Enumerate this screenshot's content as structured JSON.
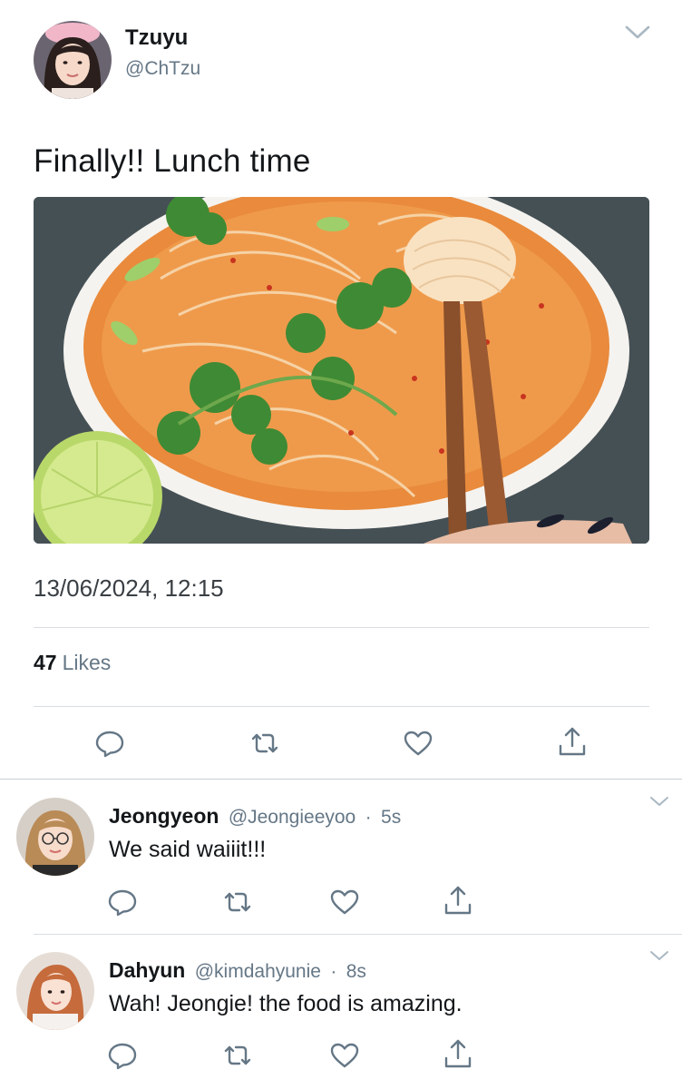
{
  "tweet": {
    "author_name": "Tzuyu",
    "author_handle": "@ChTzu",
    "text": "Finally!! Lunch time",
    "timestamp": "13/06/2024, 12:15",
    "likes_count": "47",
    "likes_label": "Likes",
    "image_subject": "Bowl of red curry noodle soup with cilantro, chopsticks and lime"
  },
  "replies": [
    {
      "name": "Jeongyeon",
      "handle": "@Jeongieeyoo",
      "separator": "·",
      "time": "5s",
      "text": "We said waiiit!!!"
    },
    {
      "name": "Dahyun",
      "handle": "@kimdahyunie",
      "separator": "·",
      "time": "8s",
      "text": "Wah! Jeongie! the food is amazing."
    }
  ],
  "icons": {
    "reply": "reply-icon",
    "retweet": "retweet-icon",
    "like": "heart-icon",
    "share": "share-icon",
    "more": "chevron-down-icon"
  },
  "colors": {
    "text_primary": "#14171a",
    "text_secondary": "#657786",
    "icon": "#657786",
    "divider": "#d8dde1"
  }
}
